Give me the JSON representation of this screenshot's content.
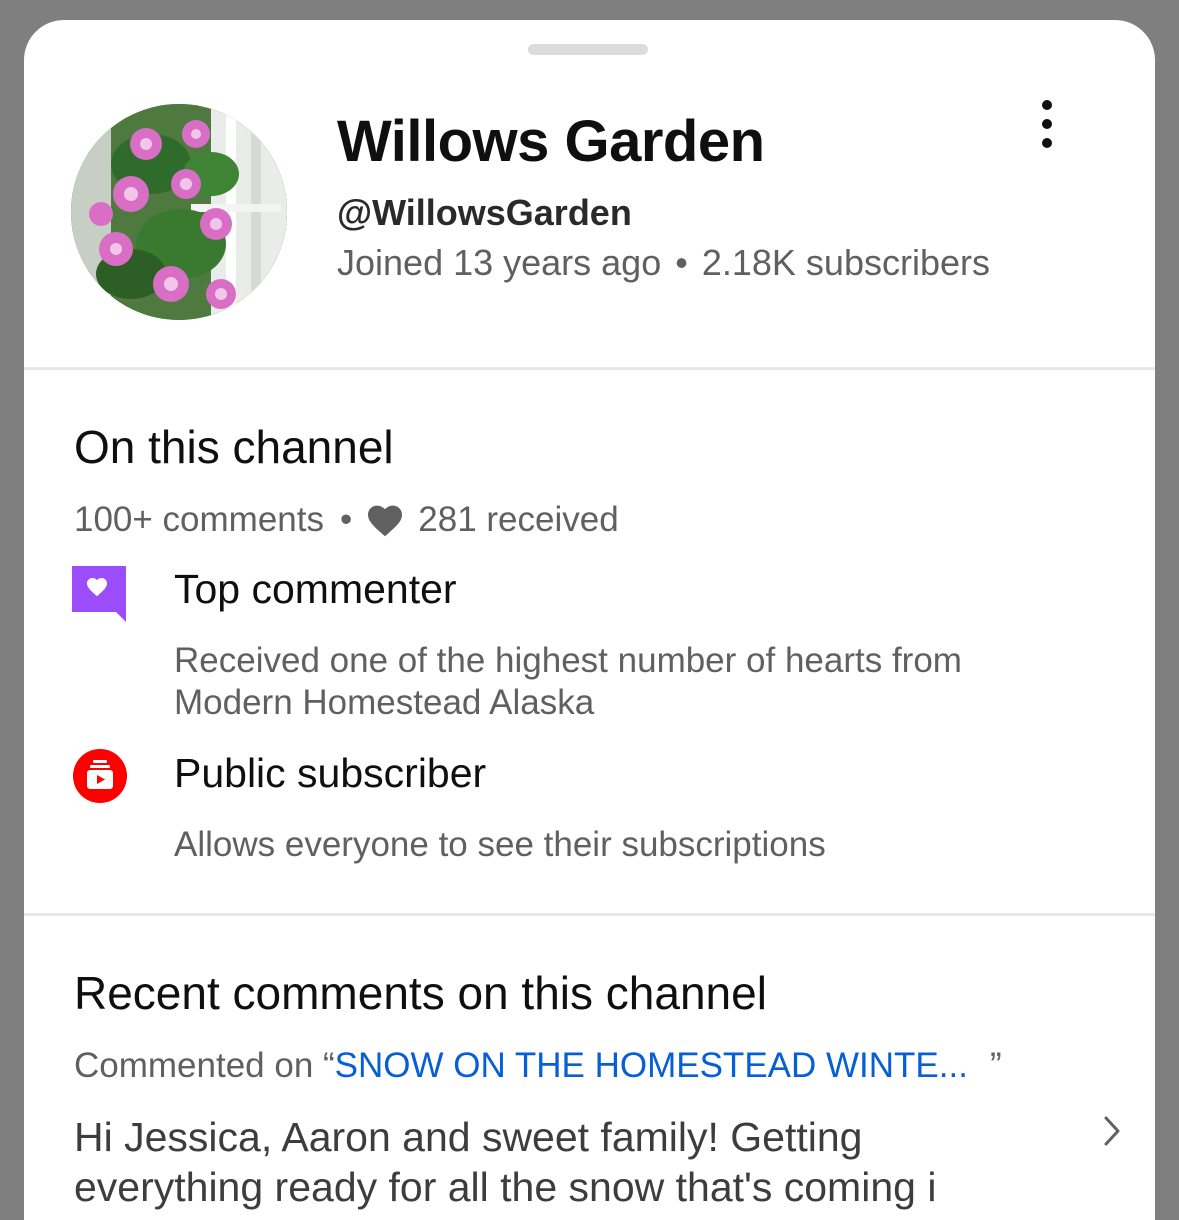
{
  "channel": {
    "name": "Willows Garden",
    "handle": "@WillowsGarden",
    "joined": "Joined 13 years ago",
    "separator": "•",
    "subscribers": "2.18K subscribers",
    "avatar_icon": "clematis-flower-photo",
    "more_icon": "vertical-ellipsis-icon"
  },
  "on_this_channel": {
    "title": "On this channel",
    "comments": "100+ comments",
    "separator": "•",
    "hearts_icon": "heart-icon",
    "hearts_received": "281 received",
    "badges": [
      {
        "title": "Top commenter",
        "description": "Received one of the highest number of hearts from Modern Homestead Alaska",
        "icon": "heart-speech-bubble-icon",
        "color": "#9b4dfc"
      },
      {
        "title": "Public subscriber",
        "description": "Allows everyone to see their subscriptions",
        "icon": "subscriptions-icon",
        "color": "#ff0000"
      }
    ]
  },
  "recent_comments": {
    "title": "Recent comments on this channel",
    "items": [
      {
        "prefix": "Commented on “",
        "video_title": "SNOW ON THE HOMESTEAD WINTE...",
        "suffix": "”",
        "text": "Hi Jessica, Aaron and sweet family! Getting everything ready for all the snow that's coming i",
        "chevron_icon": "chevron-right-icon"
      }
    ]
  },
  "colors": {
    "link": "#065fd4",
    "secondary_text": "#606060",
    "primary_text": "#0f0f0f"
  }
}
